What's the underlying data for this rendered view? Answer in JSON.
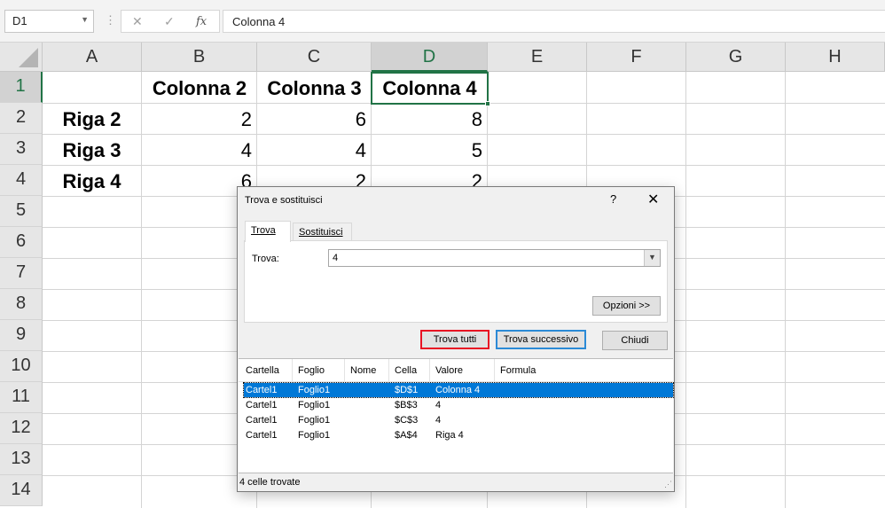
{
  "formula_bar": {
    "name_box": "D1",
    "separator": "⋮",
    "cancel_icon": "✕",
    "enter_icon": "✓",
    "fx_label": "fx",
    "formula": "Colonna 4"
  },
  "columns": [
    "A",
    "B",
    "C",
    "D",
    "E",
    "F",
    "G",
    "H"
  ],
  "rows": [
    "1",
    "2",
    "3",
    "4",
    "5",
    "6",
    "7",
    "8",
    "9",
    "10",
    "11",
    "12",
    "13",
    "14"
  ],
  "cells": {
    "B1": "Colonna 2",
    "C1": "Colonna 3",
    "D1": "Colonna 4",
    "A2": "Riga 2",
    "B2": "2",
    "C2": "6",
    "D2": "8",
    "A3": "Riga 3",
    "B3": "4",
    "C3": "4",
    "D3": "5",
    "A4": "Riga 4",
    "B4": "6",
    "C4": "2",
    "D4": "2"
  },
  "dialog": {
    "title": "Trova e sostituisci",
    "help": "?",
    "close": "✕",
    "tabs": {
      "find": "Trova",
      "replace": "Sostituisci"
    },
    "find_label": "Trova:",
    "find_value": "4",
    "options_button": "Opzioni >>",
    "find_all_button": "Trova tutti",
    "find_next_button": "Trova successivo",
    "close_button": "Chiudi",
    "result_headers": [
      "Cartella",
      "Foglio",
      "Nome",
      "Cella",
      "Valore",
      "Formula"
    ],
    "results": [
      {
        "workbook": "Cartel1",
        "sheet": "Foglio1",
        "name": "",
        "cell": "$D$1",
        "value": "Colonna 4",
        "formula": ""
      },
      {
        "workbook": "Cartel1",
        "sheet": "Foglio1",
        "name": "",
        "cell": "$B$3",
        "value": "4",
        "formula": ""
      },
      {
        "workbook": "Cartel1",
        "sheet": "Foglio1",
        "name": "",
        "cell": "$C$3",
        "value": "4",
        "formula": ""
      },
      {
        "workbook": "Cartel1",
        "sheet": "Foglio1",
        "name": "",
        "cell": "$A$4",
        "value": "Riga 4",
        "formula": ""
      }
    ],
    "status": "4 celle trovate"
  },
  "colors": {
    "accent": "#217346",
    "highlight_red": "#e81123",
    "selection_blue": "#0078d7"
  }
}
